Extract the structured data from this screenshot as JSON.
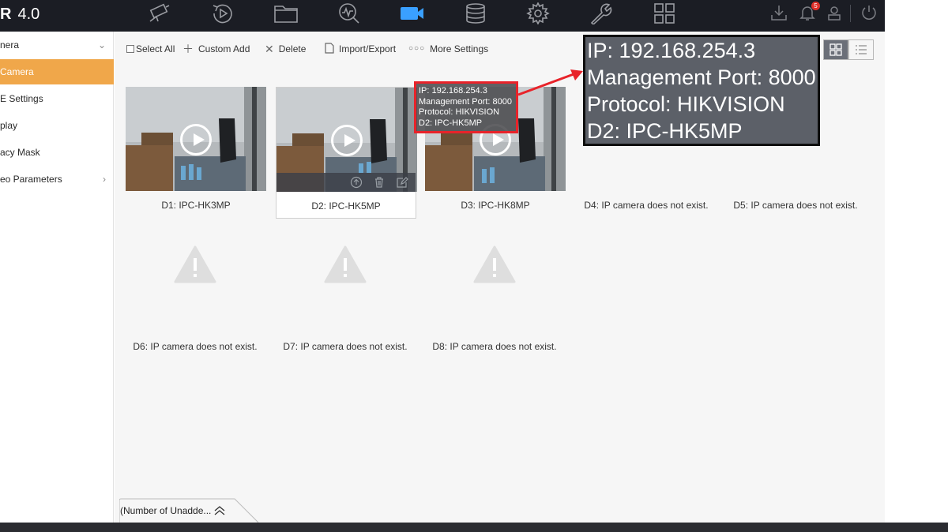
{
  "header": {
    "brand_mark": "R",
    "version": "4.0",
    "nav_icons": [
      "camera-icon",
      "playback-icon",
      "folder-icon",
      "search-icon",
      "video-camera-icon",
      "storage-icon",
      "settings-icon",
      "maintenance-icon",
      "grid-icon"
    ],
    "active_nav": "video-camera-icon",
    "notification_count": "5"
  },
  "sidebar": {
    "items": [
      {
        "label": "nera",
        "expand": "⌄"
      },
      {
        "label": "Camera"
      },
      {
        "label": "E Settings"
      },
      {
        "label": "play"
      },
      {
        "label": "acy Mask"
      },
      {
        "label": "eo Parameters",
        "expand": "›"
      }
    ]
  },
  "toolbar": {
    "select_all": "Select All",
    "custom_add": "Custom Add",
    "delete": "Delete",
    "import_export": "Import/Export",
    "more_settings": "More Settings"
  },
  "cameras": [
    {
      "label": "D1: IPC-HK3MP"
    },
    {
      "label": "D2: IPC-HK5MP"
    },
    {
      "label": "D3: IPC-HK8MP"
    }
  ],
  "empty_slots": [
    {
      "label": "D4: IP camera does not exist."
    },
    {
      "label": "D5: IP camera does not exist."
    },
    {
      "label": "D6: IP camera does not exist."
    },
    {
      "label": "D7: IP camera does not exist."
    },
    {
      "label": "D8: IP camera does not exist."
    }
  ],
  "info_popup": {
    "ip": "IP: 192.168.254.3",
    "port": "Management Port: 8000",
    "protocol": "Protocol: HIKVISION",
    "device": "D2: IPC-HK5MP"
  },
  "footer": {
    "unadded_label": "(Number of Unadde..."
  },
  "colors": {
    "accent": "#f0a74a",
    "highlight_border": "#e8232a",
    "active_nav": "#3aa0ff"
  }
}
